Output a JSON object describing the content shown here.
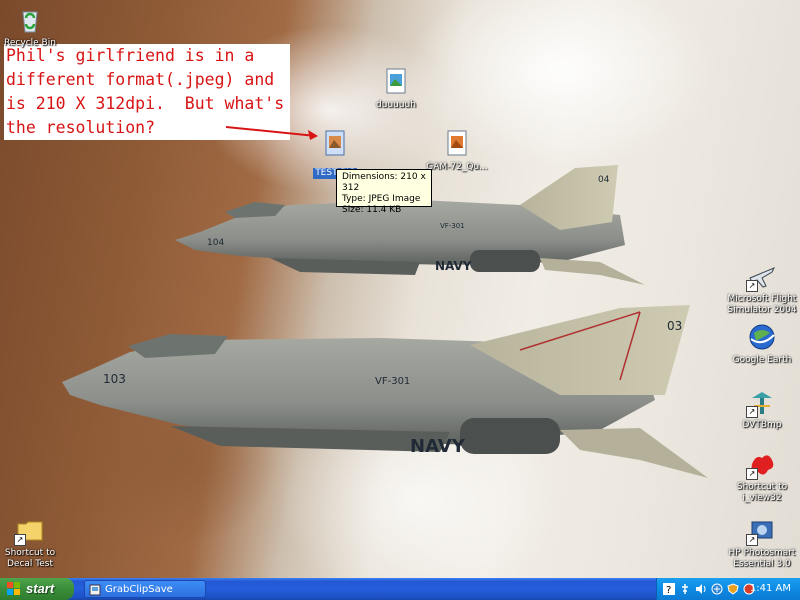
{
  "desktop": {
    "annotation": {
      "lines": [
        "Phil's girlfriend is in a",
        "different format(.jpeg) and",
        "is 210 X 312dpi.  But what's",
        "the resolution?"
      ]
    },
    "icons": {
      "recycle_bin": "Recycle Bin",
      "duuuuuh": "duuuuuh",
      "test_pic": "TEST PIC",
      "gam72": "GAM-72_Qu...",
      "flight_sim": [
        "Microsoft Flight",
        "Simulator 2004"
      ],
      "google_earth": "Google Earth",
      "dvtbmp": "DVTBmp",
      "i_view32": [
        "Shortcut to",
        "i_view32"
      ],
      "hp_photosmart": [
        "HP Photosmart",
        "Essential 3.0"
      ],
      "decal_test": [
        "Shortcut to",
        "Decal Test"
      ]
    },
    "tooltip": {
      "dimensions": "Dimensions: 210 x 312",
      "type": "Type: JPEG Image",
      "size": "Size: 11.4 KB"
    }
  },
  "taskbar": {
    "start_label": "start",
    "task_item": "GrabClipSave",
    "clock": "1:41 AM"
  },
  "colors": {
    "annotation_text": "#d81414",
    "taskbar_blue": "#245edb",
    "start_green": "#3c8f3c",
    "selection_blue": "#316ac5",
    "tooltip_bg": "#ffffe1"
  }
}
